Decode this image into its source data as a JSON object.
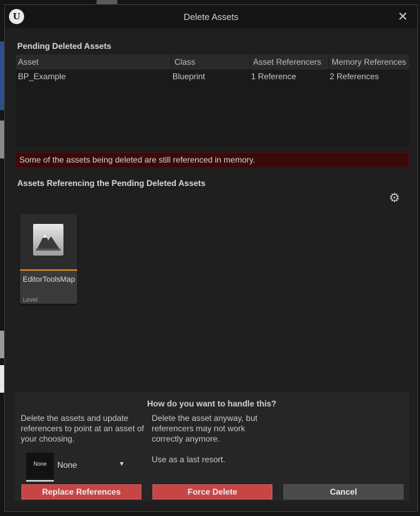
{
  "dialog": {
    "title": "Delete Assets",
    "logo": "U"
  },
  "pending": {
    "section_title": "Pending Deleted Assets",
    "columns": [
      "Asset",
      "Class",
      "Asset Referencers",
      "Memory References"
    ],
    "rows": [
      {
        "asset": "BP_Example",
        "class": "Blueprint",
        "asset_referencers": "1 Reference",
        "memory_references": "2 References"
      }
    ]
  },
  "warning": {
    "text": "Some of the assets being deleted are still referenced in memory.",
    "color": "#3a0a0a"
  },
  "referencing": {
    "section_title": "Assets Referencing the Pending Deleted Assets",
    "settings_icon": "gear-icon",
    "tiles": [
      {
        "name": "EditorToolsMap",
        "type": "Level",
        "icon": "level-map-icon",
        "accent": "#e08a1e"
      }
    ]
  },
  "handling": {
    "question": "How do you want to handle this?",
    "replace_desc": "Delete the assets and update referencers to point at an asset of your choosing.",
    "force_desc": "Delete the asset anyway, but referencers may not work correctly anymore.",
    "force_note": "Use as a last resort.",
    "picker": {
      "thumb_label": "None",
      "value": "None"
    },
    "buttons": {
      "replace": "Replace References",
      "force": "Force Delete",
      "cancel": "Cancel"
    },
    "colors": {
      "danger": "#c74545",
      "neutral": "#4a4a4a"
    }
  }
}
